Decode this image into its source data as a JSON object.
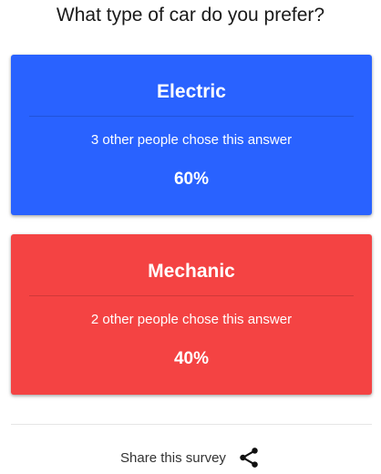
{
  "survey": {
    "question": "What type of car do you prefer?"
  },
  "answers": [
    {
      "label": "Electric",
      "subtext": "3 other people chose this answer",
      "percent": "60%",
      "color": "#2962ff"
    },
    {
      "label": "Mechanic",
      "subtext": "2 other people chose this answer",
      "percent": "40%",
      "color": "#f44343"
    }
  ],
  "footer": {
    "share_label": "Share this survey",
    "share_icon": "share-icon"
  }
}
